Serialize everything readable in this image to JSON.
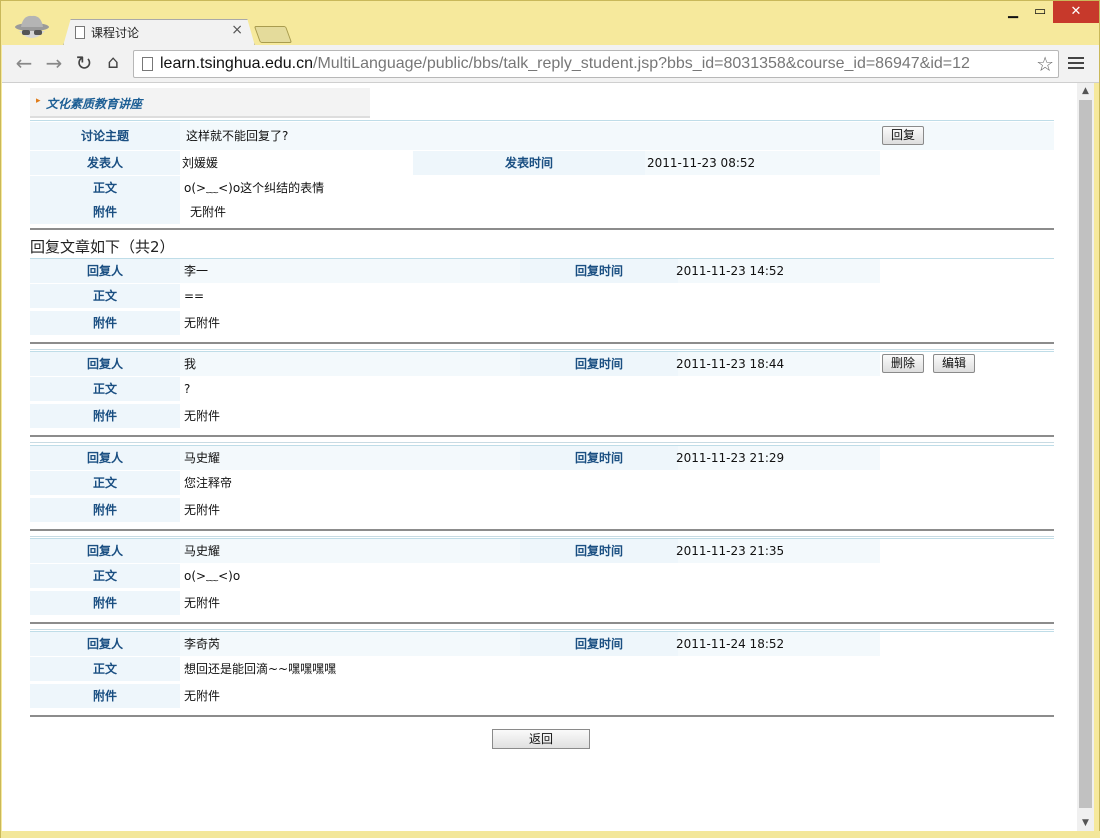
{
  "browser": {
    "tab_title": "课程讨论",
    "tab_close": "×",
    "url_host": "learn.tsinghua.edu.cn",
    "url_path": "/MultiLanguage/public/bbs/talk_reply_student.jsp?bbs_id=8031358&course_id=86947&id=12"
  },
  "course": {
    "name": "文化素质教育讲座"
  },
  "topic": {
    "subject_label": "讨论主题",
    "subject": "这样就不能回复了?",
    "reply_button": "回复",
    "author_label": "发表人",
    "author": "刘媛媛",
    "time_label": "发表时间",
    "time": "2011-11-23 08:52",
    "body_label": "正文",
    "body": "o(>﹏<)o这个纠结的表情",
    "attach_label": "附件",
    "attach": "无附件"
  },
  "replies_heading": "回复文章如下（共2）",
  "reply_labels": {
    "author": "回复人",
    "time": "回复时间",
    "body": "正文",
    "attach": "附件"
  },
  "replies": [
    {
      "author": "李一",
      "time": "2011-11-23 14:52",
      "body": "==",
      "attach": "无附件"
    },
    {
      "author": "我",
      "time": "2011-11-23 18:44",
      "body": "?",
      "attach": "无附件",
      "delete_button": "删除",
      "edit_button": "编辑"
    },
    {
      "author": "马史耀",
      "time": "2011-11-23 21:29",
      "body": "您注释帝",
      "attach": "无附件"
    },
    {
      "author": "马史耀",
      "time": "2011-11-23 21:35",
      "body": "o(>﹏<)o",
      "attach": "无附件"
    },
    {
      "author": "李奇芮",
      "time": "2011-11-24 18:52",
      "body": "想回还是能回滴~~嘿嘿嘿嘿",
      "attach": "无附件"
    }
  ],
  "return_button": "返回"
}
